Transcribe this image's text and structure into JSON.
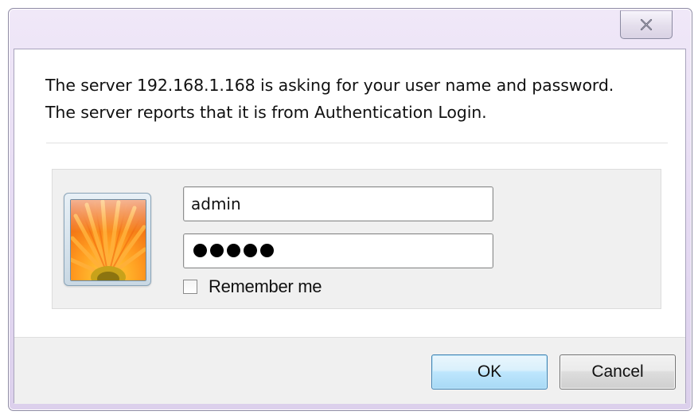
{
  "dialog": {
    "message_line1": "The server 192.168.1.168 is asking for your user name and password.",
    "message_line2": "The server reports that it is from Authentication Login.",
    "close_icon": "close-icon"
  },
  "credentials": {
    "username_value": "admin",
    "password_value": "•••••",
    "password_masked_length": 5,
    "remember_label": "Remember me",
    "remember_checked": false,
    "avatar_icon": "user-avatar-flower-icon"
  },
  "buttons": {
    "ok_label": "OK",
    "cancel_label": "Cancel"
  },
  "colors": {
    "frame": "#e6dbf3",
    "ok_border": "#3c7fb1",
    "panel_bg": "#f0f0f0"
  }
}
